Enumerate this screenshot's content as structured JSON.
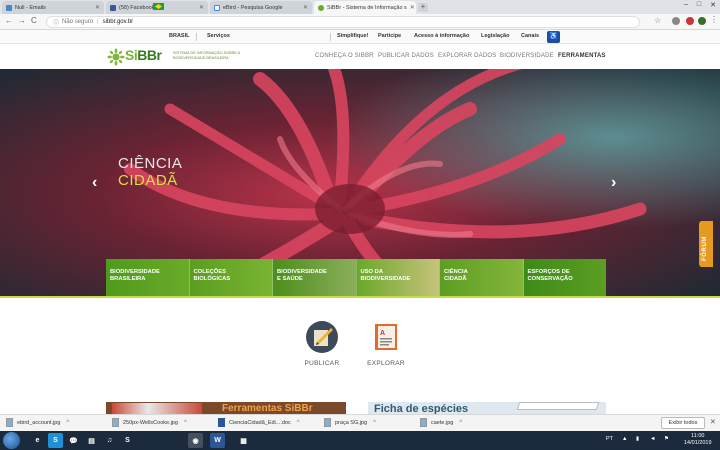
{
  "browser": {
    "tabs": [
      {
        "label": "Null - Emails",
        "color": "#4a86c8",
        "active": false
      },
      {
        "label": "(58) Facebook",
        "color": "#3b5998",
        "active": false
      },
      {
        "label": "eBird - Pesquisa Google",
        "color": "#ffffff",
        "active": false
      },
      {
        "label": "SiBBr - Sistema de Informação s",
        "color": "#6aab2a",
        "active": true
      }
    ],
    "new_tab": "+",
    "window_controls": [
      "–",
      "□",
      "✕"
    ],
    "nav": {
      "back": "←",
      "forward": "→",
      "reload": "C"
    },
    "security_label": "Não seguro",
    "url": "sibbr.gov.br"
  },
  "govbar": {
    "country": "BRASIL",
    "services": "Serviços",
    "links": [
      "Simplifique!",
      "Participe",
      "Acesso à informação",
      "Legislação",
      "Canais"
    ]
  },
  "site": {
    "logo_prefix": "Si",
    "logo_suffix": "BBr",
    "logo_desc": "Sistema de Informação sobre a Biodiversidade Brasileira",
    "nav": [
      "Conheça o SiBBr",
      "Publicar dados",
      "Explorar dados",
      "Biodiversidade",
      "Ferramentas"
    ]
  },
  "hero": {
    "title_line1": "CIÊNCIA",
    "title_line2": "CIDADÃ",
    "prev_arrow": "‹",
    "next_arrow": "›",
    "forum_label": "FÓRUM",
    "categories": [
      [
        "BIODIVERSIDADE",
        "BRASILEIRA"
      ],
      [
        "COLEÇÕES",
        "BIOLÓGICAS"
      ],
      [
        "BIODIVERSIDADE",
        "E SAÚDE"
      ],
      [
        "USO DA",
        "BIODIVERSIDADE"
      ],
      [
        "CIÊNCIA",
        "CIDADÃ"
      ],
      [
        "ESFORÇOS DE",
        "CONSERVAÇÃO"
      ]
    ]
  },
  "features": [
    {
      "label": "PUBLICAR",
      "icon": "publish-icon"
    },
    {
      "label": "EXPLORAR",
      "icon": "explore-book-icon"
    }
  ],
  "banners": {
    "tools": "Ferramentas SiBBr",
    "species": "Ficha de espécies"
  },
  "downloads": {
    "items": [
      {
        "name": "ebird_account.jpg",
        "type": "pic"
      },
      {
        "name": "250px-WellsCooke.jpg",
        "type": "pic"
      },
      {
        "name": "CienciaCidadã_Edi....doc",
        "type": "doc"
      },
      {
        "name": "praça SG.jpg",
        "type": "pic"
      },
      {
        "name": "caete.jpg",
        "type": "pic"
      }
    ],
    "show_all": "Exibir todos",
    "close": "✕"
  },
  "taskbar": {
    "apps": [
      "e",
      "S",
      "◉",
      "▤",
      "♫",
      "W",
      "▦"
    ],
    "language": "PT",
    "time": "11:00",
    "date": "14/01/2019"
  },
  "colors": {
    "brand_green": "#6aab2a",
    "accent_yellow": "#d7e23a",
    "forum_orange": "#e69a22"
  }
}
